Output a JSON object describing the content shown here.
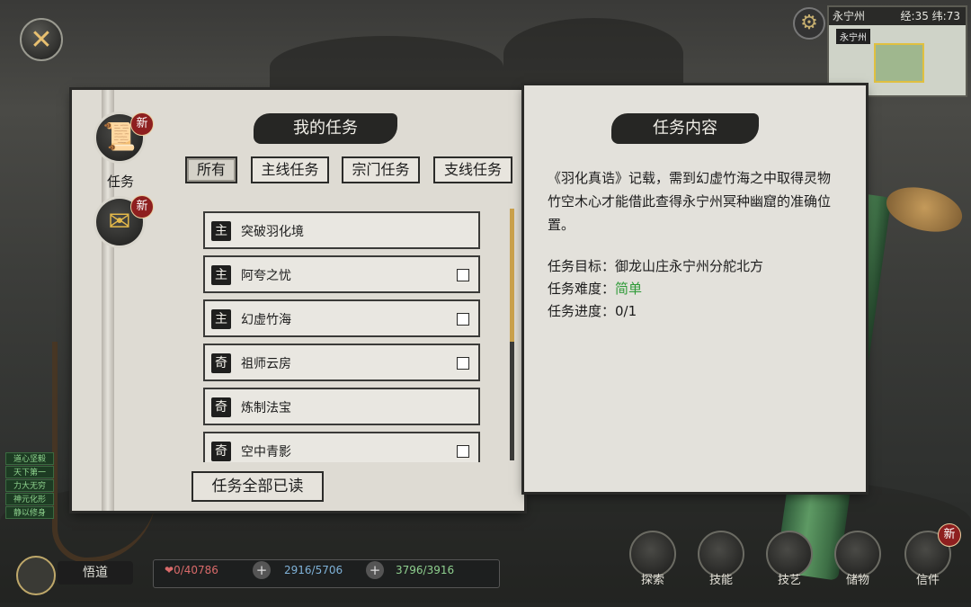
{
  "hud_top": {
    "minimap_name": "永宁州",
    "minimap_coords": "经:35 纬:73",
    "minimap_region": "永宁州"
  },
  "side_tabs": {
    "quest_label": "任务",
    "new_badge": "新"
  },
  "quest_panel": {
    "title": "我的任务",
    "filters": [
      "所有",
      "主线任务",
      "宗门任务",
      "支线任务"
    ],
    "active_filter": "所有",
    "quests": [
      {
        "tag": "主",
        "name": "突破羽化境",
        "checkbox": false
      },
      {
        "tag": "主",
        "name": "阿夸之忧",
        "checkbox": true
      },
      {
        "tag": "主",
        "name": "幻虚竹海",
        "checkbox": true
      },
      {
        "tag": "奇",
        "name": "祖师云房",
        "checkbox": true
      },
      {
        "tag": "奇",
        "name": "炼制法宝",
        "checkbox": false
      },
      {
        "tag": "奇",
        "name": "空中青影",
        "checkbox": true
      }
    ],
    "scroll_position": 0.0,
    "mark_all_read": "任务全部已读"
  },
  "content_panel": {
    "title": "任务内容",
    "description": "《羽化真诰》记载，需到幻虚竹海之中取得灵物竹空木心才能借此查得永宁州冥种幽窟的准确位置。",
    "target_label": "任务目标：",
    "target_value": "御龙山庄永宁州分舵北方",
    "difficulty_label": "任务难度：",
    "difficulty_value": "简单",
    "progress_label": "任务进度：",
    "progress_value": "0/1"
  },
  "hud_bottom": {
    "char_button_label": "悟道",
    "hp": "0/40786",
    "mp": "2916/5706",
    "sp": "3796/3916",
    "icons": [
      {
        "label": "探索"
      },
      {
        "label": "技能"
      },
      {
        "label": "技艺"
      },
      {
        "label": "储物"
      },
      {
        "label": "信件"
      }
    ]
  },
  "buffs": [
    "道心坚毅",
    "天下第一",
    "力大无穷",
    "神元化形",
    "静以修身"
  ],
  "colors": {
    "difficulty_easy": "#2e9a37",
    "accent_gold": "#c9a04a",
    "new_badge": "#8e1f1f"
  }
}
